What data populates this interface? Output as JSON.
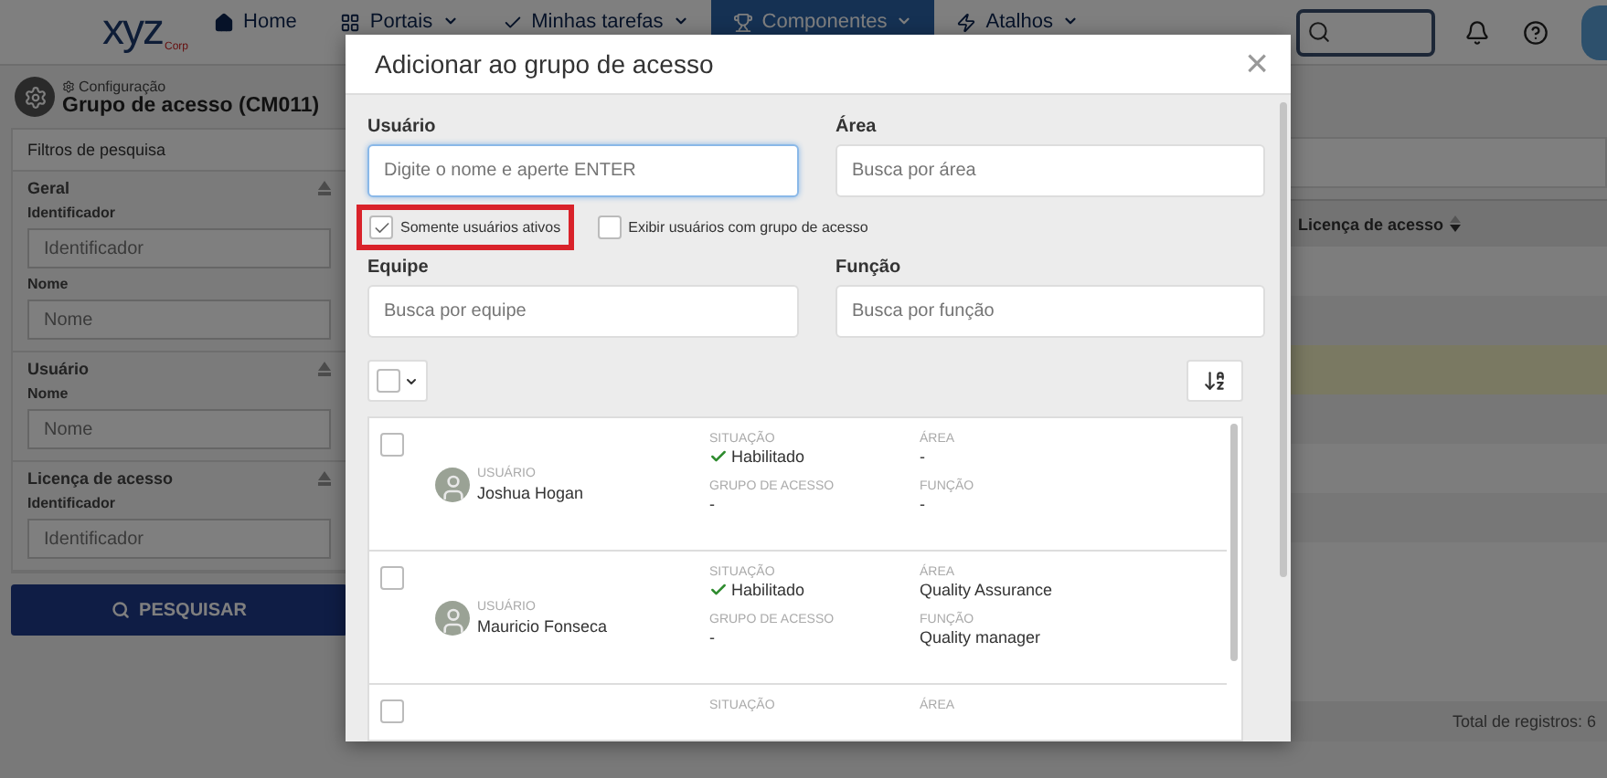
{
  "navbar": {
    "logo": {
      "text": "xyz",
      "subtext": "Corp"
    },
    "items": [
      {
        "label": "Home",
        "dropdown": false,
        "selected": false
      },
      {
        "label": "Portais",
        "dropdown": true,
        "selected": false
      },
      {
        "label": "Minhas tarefas",
        "dropdown": true,
        "selected": false
      },
      {
        "label": "Componentes",
        "dropdown": true,
        "selected": true
      },
      {
        "label": "Atalhos",
        "dropdown": true,
        "selected": false
      }
    ]
  },
  "page_header": {
    "breadcrumb": "Configuração",
    "title": "Grupo de acesso (CM011)"
  },
  "filters": {
    "title": "Filtros de pesquisa",
    "sections": [
      {
        "title": "Geral",
        "fields": [
          {
            "label": "Identificador",
            "placeholder": "Identificador"
          },
          {
            "label": "Nome",
            "placeholder": "Nome"
          }
        ]
      },
      {
        "title": "Usuário",
        "fields": [
          {
            "label": "Nome",
            "placeholder": "Nome"
          }
        ]
      },
      {
        "title": "Licença de acesso",
        "fields": [
          {
            "label": "Identificador",
            "placeholder": "Identificador"
          }
        ]
      }
    ],
    "search_button": "PESQUISAR"
  },
  "table": {
    "columns": [
      {
        "label": "Licença de acesso"
      }
    ],
    "rows": [
      {
        "selected": false
      },
      {
        "selected": false
      },
      {
        "selected": true
      },
      {
        "selected": false
      },
      {
        "selected": false
      },
      {
        "selected": false
      }
    ],
    "total": "Total de registros: 6"
  },
  "modal": {
    "title": "Adicionar ao grupo de acesso",
    "close": "×",
    "fields": [
      {
        "label": "Usuário",
        "placeholder": "Digite o nome e aperte ENTER",
        "focused": true
      },
      {
        "label": "Área",
        "placeholder": "Busca por área",
        "focused": false
      },
      {
        "label": "Equipe",
        "placeholder": "Busca por equipe",
        "focused": false
      },
      {
        "label": "Função",
        "placeholder": "Busca por função",
        "focused": false
      }
    ],
    "options": [
      {
        "label": "Somente usuários ativos",
        "checked": true,
        "highlighted": true
      },
      {
        "label": "Exibir usuários com grupo de acesso",
        "checked": false,
        "highlighted": false
      }
    ],
    "select_all": {
      "checked": false
    },
    "users": [
      {
        "checked": false,
        "user_label": "USUÁRIO",
        "name": "Joshua Hogan",
        "status_label": "SITUAÇÃO",
        "status": "Habilitado",
        "group_label": "GRUPO DE ACESSO",
        "group": "-",
        "area_label": "ÁREA",
        "area": "-",
        "role_label": "FUNÇÃO",
        "role": "-"
      },
      {
        "checked": false,
        "user_label": "USUÁRIO",
        "name": "Mauricio Fonseca",
        "status_label": "SITUAÇÃO",
        "status": "Habilitado",
        "group_label": "GRUPO DE ACESSO",
        "group": "-",
        "area_label": "ÁREA",
        "area": "Quality Assurance",
        "role_label": "FUNÇÃO",
        "role": "Quality manager"
      },
      {
        "checked": false,
        "status_label": "SITUAÇÃO",
        "area_label": "ÁREA"
      }
    ]
  }
}
